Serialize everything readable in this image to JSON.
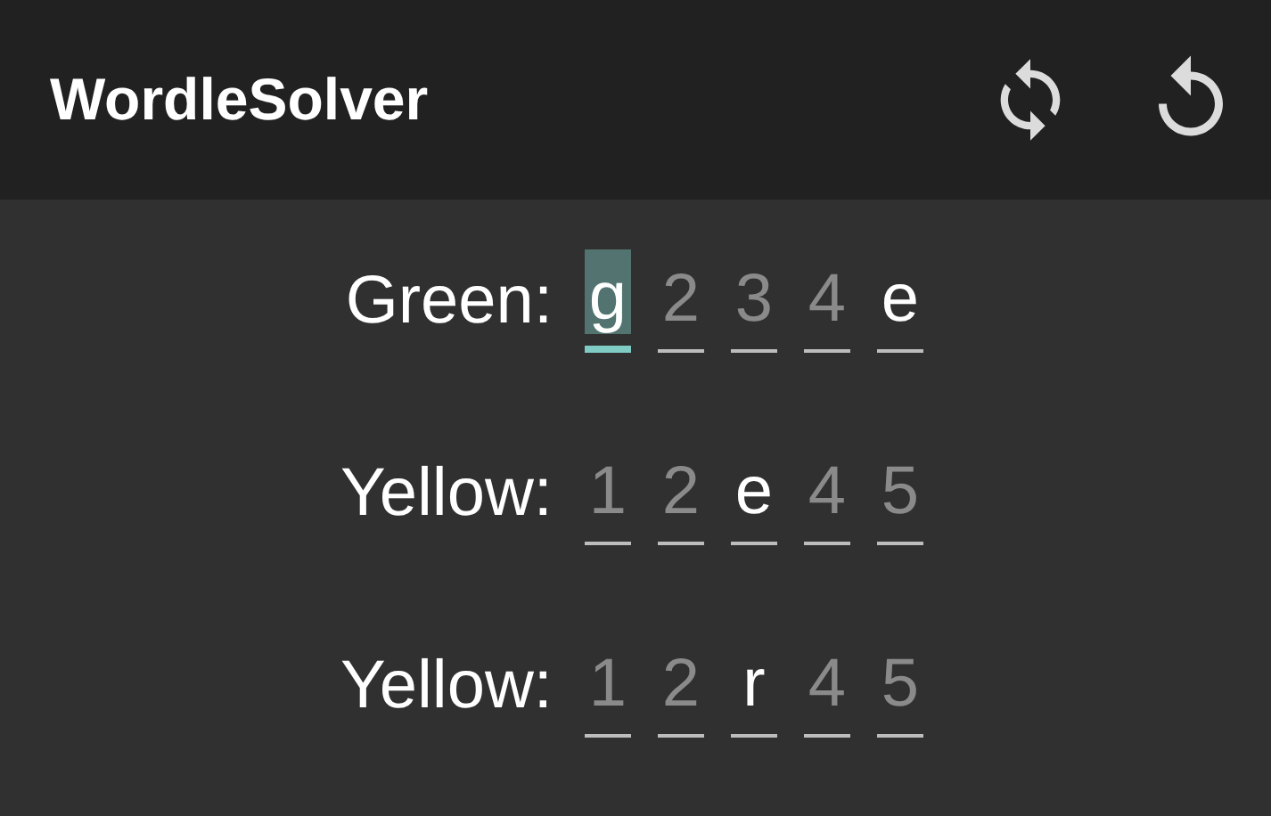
{
  "app_bar": {
    "title": "WordleSolver"
  },
  "rows": [
    {
      "label": "Green:",
      "cells": [
        {
          "value": "g",
          "focused": true
        },
        {
          "placeholder": "2",
          "focused": false
        },
        {
          "placeholder": "3",
          "focused": false
        },
        {
          "placeholder": "4",
          "focused": false
        },
        {
          "value": "e",
          "focused": false
        }
      ]
    },
    {
      "label": "Yellow:",
      "cells": [
        {
          "placeholder": "1",
          "focused": false
        },
        {
          "placeholder": "2",
          "focused": false
        },
        {
          "value": "e",
          "focused": false
        },
        {
          "placeholder": "4",
          "focused": false
        },
        {
          "placeholder": "5",
          "focused": false
        }
      ]
    },
    {
      "label": "Yellow:",
      "cells": [
        {
          "placeholder": "1",
          "focused": false
        },
        {
          "placeholder": "2",
          "focused": false
        },
        {
          "value": "r",
          "focused": false
        },
        {
          "placeholder": "4",
          "focused": false
        },
        {
          "placeholder": "5",
          "focused": false
        }
      ]
    }
  ]
}
